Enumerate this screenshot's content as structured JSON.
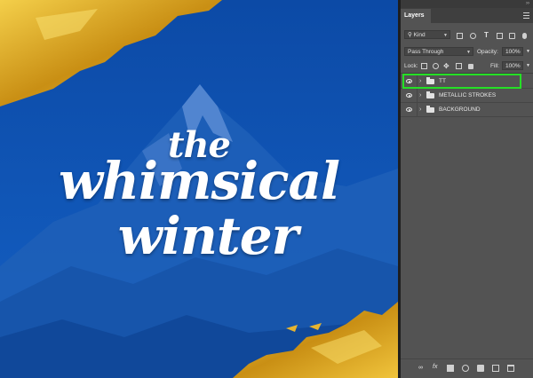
{
  "canvas": {
    "artwork_line1": "the",
    "artwork_line2": "whimsical",
    "artwork_line3": "winter",
    "background_color": "#0f56b8",
    "accent_gold": "#d9a722"
  },
  "layers_panel": {
    "tab_label": "Layers",
    "filter": {
      "kind_label": "Kind"
    },
    "blend_mode": "Pass Through",
    "opacity_label": "Opacity:",
    "opacity_value": "100%",
    "lock_label": "Lock:",
    "fill_label": "Fill:",
    "fill_value": "100%",
    "layers": [
      {
        "name": "TT",
        "type": "group",
        "visible": true,
        "selected": true
      },
      {
        "name": "METALLIC STROKES",
        "type": "group",
        "visible": true,
        "selected": false
      },
      {
        "name": "BACKGROUND",
        "type": "group",
        "visible": true,
        "selected": false
      }
    ],
    "highlight_color": "#25e025"
  }
}
